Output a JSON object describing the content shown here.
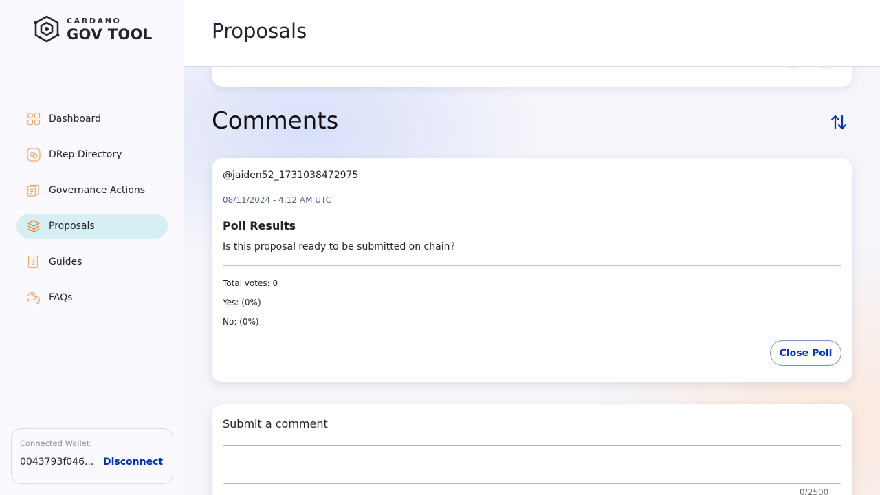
{
  "app": {
    "logo_small": "CARDANO",
    "logo_big": "GOV TOOL"
  },
  "sidebar": {
    "items": [
      {
        "label": "Dashboard",
        "icon": "dashboard-icon"
      },
      {
        "label": "DRep Directory",
        "icon": "drep-directory-icon"
      },
      {
        "label": "Governance Actions",
        "icon": "governance-actions-icon"
      },
      {
        "label": "Proposals",
        "icon": "proposals-icon",
        "active": true
      },
      {
        "label": "Guides",
        "icon": "guides-icon"
      },
      {
        "label": "FAQs",
        "icon": "faqs-icon"
      }
    ]
  },
  "wallet": {
    "caption": "Connected Wallet:",
    "address": "0043793f046...",
    "disconnect_label": "Disconnect"
  },
  "header": {
    "title": "Proposals"
  },
  "comments": {
    "title": "Comments",
    "sort_icon": "sort-arrows-icon"
  },
  "poll": {
    "author": "@jaiden52_1731038472975",
    "date": "08/11/2024 - 4:12 AM UTC",
    "heading": "Poll Results",
    "question": "Is this proposal ready to be submitted on chain?",
    "total_votes": "Total votes: 0",
    "yes": "Yes: (0%)",
    "no": "No: (0%)",
    "close_label": "Close Poll"
  },
  "submit_comment": {
    "title": "Submit a comment",
    "value": "",
    "counter": "0/2500"
  },
  "colors": {
    "accent": "#0033ad",
    "nav_active_bg": "#d5eff5",
    "icon_orange": "#f4a96e"
  }
}
